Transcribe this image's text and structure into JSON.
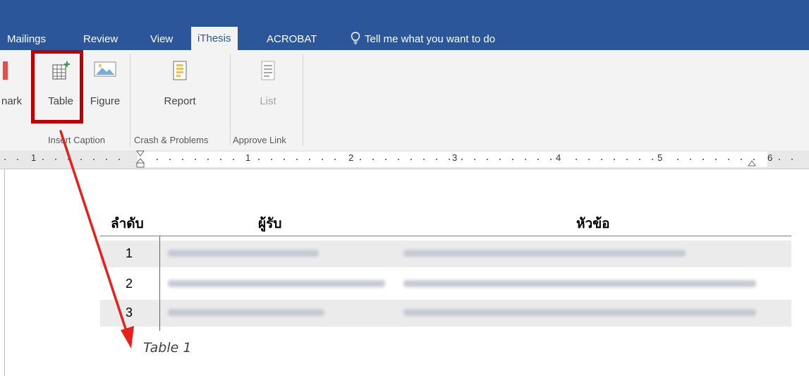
{
  "tabs": [
    {
      "label": "Mailings"
    },
    {
      "label": "Review"
    },
    {
      "label": "View"
    },
    {
      "label": "iThesis"
    },
    {
      "label": "ACROBAT"
    }
  ],
  "tell_me": "Tell me what you want to do",
  "ribbon": {
    "buttons": [
      {
        "label": "nark"
      },
      {
        "label": "Table"
      },
      {
        "label": "Figure"
      },
      {
        "label": "Report"
      },
      {
        "label": "List"
      }
    ],
    "groups": [
      {
        "label": "Insert Caption"
      },
      {
        "label": "Crash & Problems"
      },
      {
        "label": "Approve Link"
      }
    ]
  },
  "ruler": {
    "numbers": [
      "1",
      "1",
      "2",
      "3",
      "4",
      "5",
      "6"
    ]
  },
  "table": {
    "headers": [
      "ลำดับ",
      "ผู้รับ",
      "หัวข้อ"
    ],
    "rows": [
      {
        "num": "1"
      },
      {
        "num": "2"
      },
      {
        "num": "3"
      }
    ]
  },
  "caption": "Table 1",
  "colors": {
    "accent": "#2b579a",
    "highlight": "#c00000",
    "arrow": "#e8201c"
  }
}
